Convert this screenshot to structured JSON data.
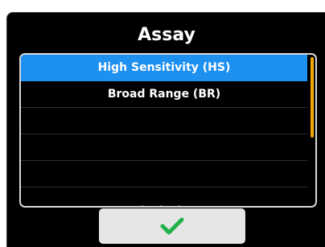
{
  "dialog": {
    "title": "Assay",
    "options": [
      {
        "label": "High Sensitivity (HS)",
        "selected": true
      },
      {
        "label": "Broad Range (BR)",
        "selected": false
      },
      {
        "label": "",
        "selected": false
      },
      {
        "label": "",
        "selected": false
      },
      {
        "label": "",
        "selected": false
      }
    ],
    "confirm_icon": "checkmark-icon"
  },
  "colors": {
    "background": "#000000",
    "selected_row": "#1e90f0",
    "scrollbar": "#f5a800",
    "confirm_button": "#e6e6e6",
    "checkmark": "#22b14c"
  }
}
